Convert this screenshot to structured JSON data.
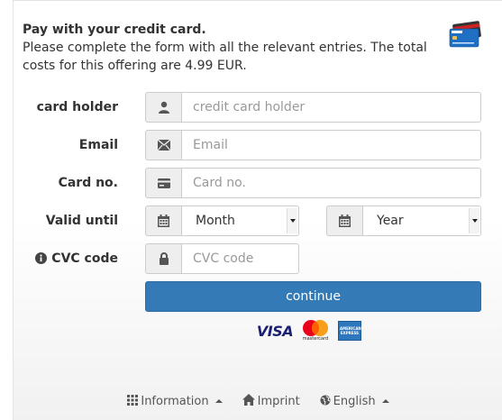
{
  "intro": {
    "title": "Pay with your credit card.",
    "text": "Please complete the form with all the relevant entries. The total costs for this offering are 4.99 EUR."
  },
  "form": {
    "card_holder": {
      "label": "card holder",
      "placeholder": "credit card holder",
      "icon": "user-icon"
    },
    "email": {
      "label": "Email",
      "placeholder": "Email",
      "icon": "envelope-icon"
    },
    "card_no": {
      "label": "Card no.",
      "placeholder": "Card no.",
      "icon": "credit-card-icon"
    },
    "valid_until": {
      "label": "Valid until",
      "month": "Month",
      "year": "Year",
      "icon": "calendar-icon"
    },
    "cvc": {
      "label": "CVC code",
      "placeholder": "CVC code",
      "icon": "lock-icon",
      "info_icon": "info-icon"
    },
    "submit": "continue"
  },
  "brands": {
    "visa": "VISA",
    "mastercard": "mastercard",
    "amex": "AMERICAN EXPRESS"
  },
  "footer": {
    "information": "Information",
    "imprint": "Imprint",
    "language": "English"
  },
  "colors": {
    "primary": "#337ab7",
    "addon_bg": "#eeeeee",
    "border": "#cccccc"
  }
}
